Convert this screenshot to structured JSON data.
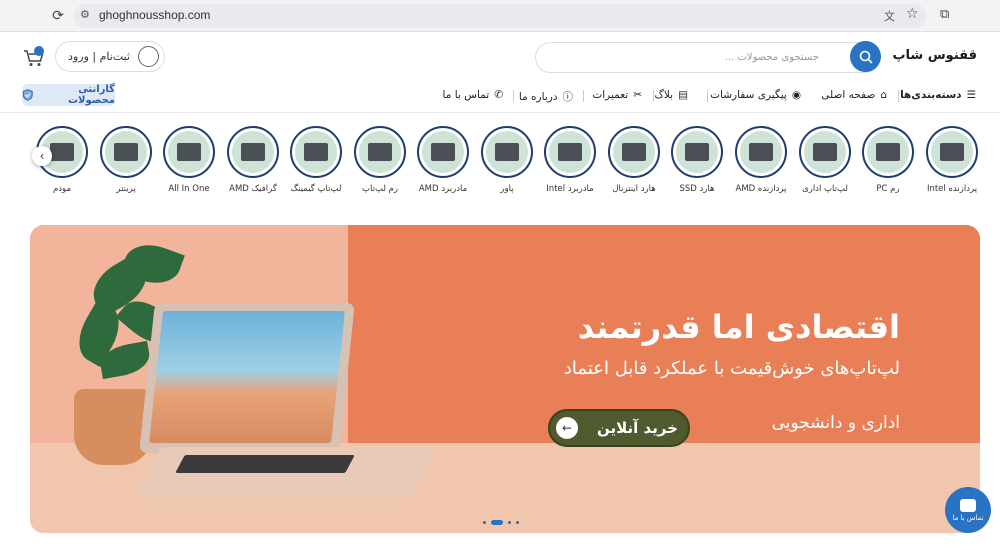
{
  "browser": {
    "url": "ghoghnousshop.com"
  },
  "header": {
    "logo": "ققنوس شاپ",
    "search_placeholder": "جستجوی محصولات ...",
    "login_label": "ثبت‌نام | ورود",
    "cart_count": ""
  },
  "nav": {
    "items": [
      {
        "label": "دسته‌بندی‌ها",
        "icon": "menu-icon"
      },
      {
        "label": "صفحه اصلی",
        "icon": "home-icon"
      },
      {
        "label": "پیگیری سفارشات",
        "icon": "location-icon"
      },
      {
        "label": "بلاگ",
        "icon": "blog-icon"
      },
      {
        "label": "تعمیرات",
        "icon": "tools-icon"
      },
      {
        "label": "درباره ما",
        "icon": "info-icon"
      },
      {
        "label": "تماس با ما",
        "icon": "phone-icon"
      }
    ],
    "guarantee": "گارانتی محصولات"
  },
  "categories": [
    "پردازنده Intel",
    "رم PC",
    "لپ‌تاپ اداری",
    "پردازنده AMD",
    "هارد SSD",
    "هارد اینترنال",
    "مادربرد Intel",
    "پاور",
    "مادربرد AMD",
    "رم لپ‌تاپ",
    "لپ‌تاپ گیمینگ",
    "گرافیک AMD",
    "All In One",
    "پرینتر",
    "مودم"
  ],
  "banner": {
    "headline": "اقتصادی اما قدرتمند",
    "subline": "لپ‌تاپ‌های خوش‌قیمت با عملکرد قابل اعتماد",
    "tag": "اداری و دانشجویی",
    "cta": "خرید آنلاین",
    "slide_count": 4,
    "active_slide": 2
  },
  "contact": {
    "label": "تماس با ما"
  },
  "colors": {
    "accent": "#2a73c4",
    "banner": "#e8835c",
    "category_ring": "#1e3f6e",
    "cta": "#4f5a2e"
  }
}
